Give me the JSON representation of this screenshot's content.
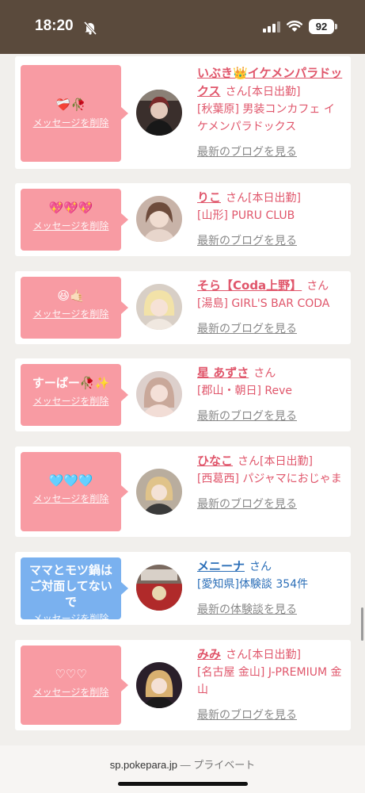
{
  "status": {
    "time": "18:20",
    "battery": "92"
  },
  "entries": [
    {
      "message": "❤️‍🩹🥀",
      "delete_label": "メッセージを削除",
      "name": "いぶき👑イケメンパラドックス",
      "honorific": "さん",
      "tag": "[本日出勤]",
      "area": "[秋葉原]",
      "shop": "男装コンカフェ イケメンパラドックス",
      "link": "最新のブログを見る",
      "avatar": "avatar-1"
    },
    {
      "message": "💖💖💖",
      "delete_label": "メッセージを削除",
      "name": "りこ",
      "honorific": "さん",
      "tag": "[本日出勤]",
      "area": "[山形]",
      "shop": "PURU CLUB",
      "link": "最新のブログを見る",
      "avatar": "avatar-2"
    },
    {
      "message": "😆🤙🏻",
      "delete_label": "メッセージを削除",
      "name": "そら【Coda上野】",
      "honorific": "さん",
      "tag": "",
      "area": "[湯島]",
      "shop": "GIRL'S BAR CODA",
      "link": "最新のブログを見る",
      "avatar": "avatar-3"
    },
    {
      "message": "すーぱー🥀✨",
      "delete_label": "メッセージを削除",
      "name": "星 あずさ",
      "honorific": "さん",
      "tag": "",
      "area": "[郡山・朝日]",
      "shop": "Reve",
      "link": "最新のブログを見る",
      "avatar": "avatar-4"
    },
    {
      "message": "🩵🩵🩵",
      "delete_label": "メッセージを削除",
      "name": "ひなこ",
      "honorific": "さん",
      "tag": "[本日出勤]",
      "area": "[西葛西]",
      "shop": "パジャマにおじゃま",
      "link": "最新のブログを見る",
      "avatar": "avatar-5"
    },
    {
      "message": "ママとモツ鍋はご対面してないで",
      "delete_label": "メッセージを削除",
      "name": "メニーナ",
      "honorific": "さん",
      "tag": "",
      "area": "[愛知県]",
      "shop": "体験談 354件",
      "link": "最新の体験談を見る",
      "avatar": "avatar-6"
    },
    {
      "message": "♡♡♡",
      "delete_label": "メッセージを削除",
      "name": "みみ",
      "honorific": "さん",
      "tag": "[本日出勤]",
      "area": "[名古屋 金山]",
      "shop": "J-PREMIUM 金山",
      "link": "最新のブログを見る",
      "avatar": "avatar-7"
    }
  ],
  "browser": {
    "url": "sp.pokepara.jp",
    "mode": "プライベート"
  }
}
